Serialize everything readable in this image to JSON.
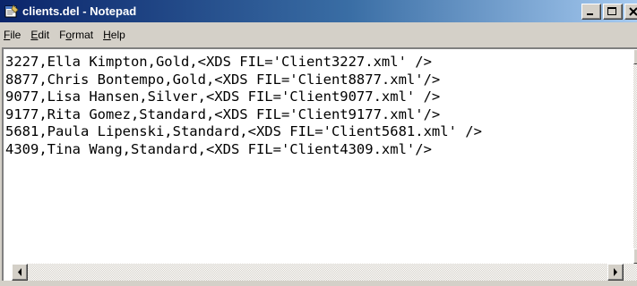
{
  "window": {
    "title": "clients.del - Notepad",
    "icon": "notepad-icon",
    "controls": [
      "minimize-icon",
      "maximize-icon",
      "close-icon"
    ]
  },
  "menu": {
    "items": [
      {
        "pre": "",
        "key": "F",
        "post": "ile"
      },
      {
        "pre": "",
        "key": "E",
        "post": "dit"
      },
      {
        "pre": "F",
        "key": "o",
        "post": "rmat"
      },
      {
        "pre": "",
        "key": "H",
        "post": "elp"
      }
    ]
  },
  "editor": {
    "lines": [
      "3227,Ella Kimpton,Gold,<XDS FIL='Client3227.xml' />",
      "8877,Chris Bontempo,Gold,<XDS FIL='Client8877.xml'/>",
      "9077,Lisa Hansen,Silver,<XDS FIL='Client9077.xml' />",
      "9177,Rita Gomez,Standard,<XDS FIL='Client9177.xml'/>",
      "5681,Paula Lipenski,Standard,<XDS FIL='Client5681.xml' />",
      "4309,Tina Wang,Standard,<XDS FIL='Client4309.xml'/>"
    ]
  },
  "scrollbars": {
    "horizontal": [
      "scroll-left-icon",
      "scroll-right-icon"
    ],
    "vertical": [
      "scroll-up-icon",
      "scroll-down-icon"
    ]
  },
  "colors": {
    "titlebar_start": "#0a246a",
    "titlebar_end": "#a6caf0",
    "chrome": "#d4d0c8"
  }
}
